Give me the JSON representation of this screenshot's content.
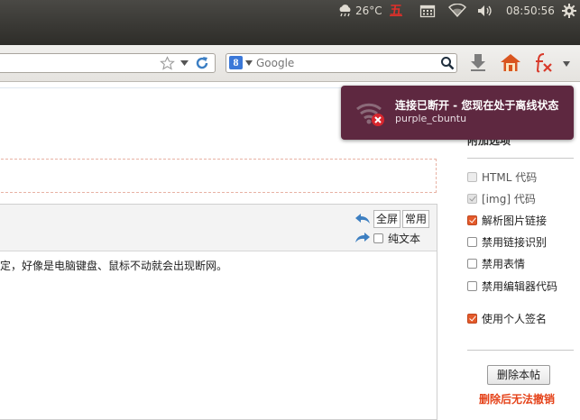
{
  "panel": {
    "weather": "26°C",
    "calendar_badge": "五",
    "time": "08:50:56"
  },
  "toolbar": {
    "search_placeholder": "Google",
    "search_engine_letter": "8"
  },
  "editor": {
    "fullscreen_label": "全屏",
    "common_label": "常用",
    "plaintext_label": "纯文本",
    "content_text": "定，好像是电脑键盘、鼠标不动就会出现断网。"
  },
  "sidebar": {
    "title": "附加选项",
    "options": [
      {
        "label": "HTML 代码",
        "checked": false,
        "disabled": true
      },
      {
        "label": "[img] 代码",
        "checked": true,
        "disabled": true
      },
      {
        "label": "解析图片链接",
        "checked": true,
        "disabled": false
      },
      {
        "label": "禁用链接识别",
        "checked": false,
        "disabled": false
      },
      {
        "label": "禁用表情",
        "checked": false,
        "disabled": false
      },
      {
        "label": "禁用编辑器代码",
        "checked": false,
        "disabled": false
      },
      {
        "label": "使用个人签名",
        "checked": true,
        "disabled": false
      }
    ],
    "delete_button": "删除本帖",
    "delete_warning": "删除后无法撤销"
  },
  "notification": {
    "title": "连接已断开 - 您现在处于离线状态",
    "subtitle": "purple_cbuntu"
  },
  "colors": {
    "panel_bg": "#3c3b37",
    "notification_bg": "#5e2840",
    "accent_orange": "#e45a2a",
    "warning_red": "#e5431a"
  }
}
